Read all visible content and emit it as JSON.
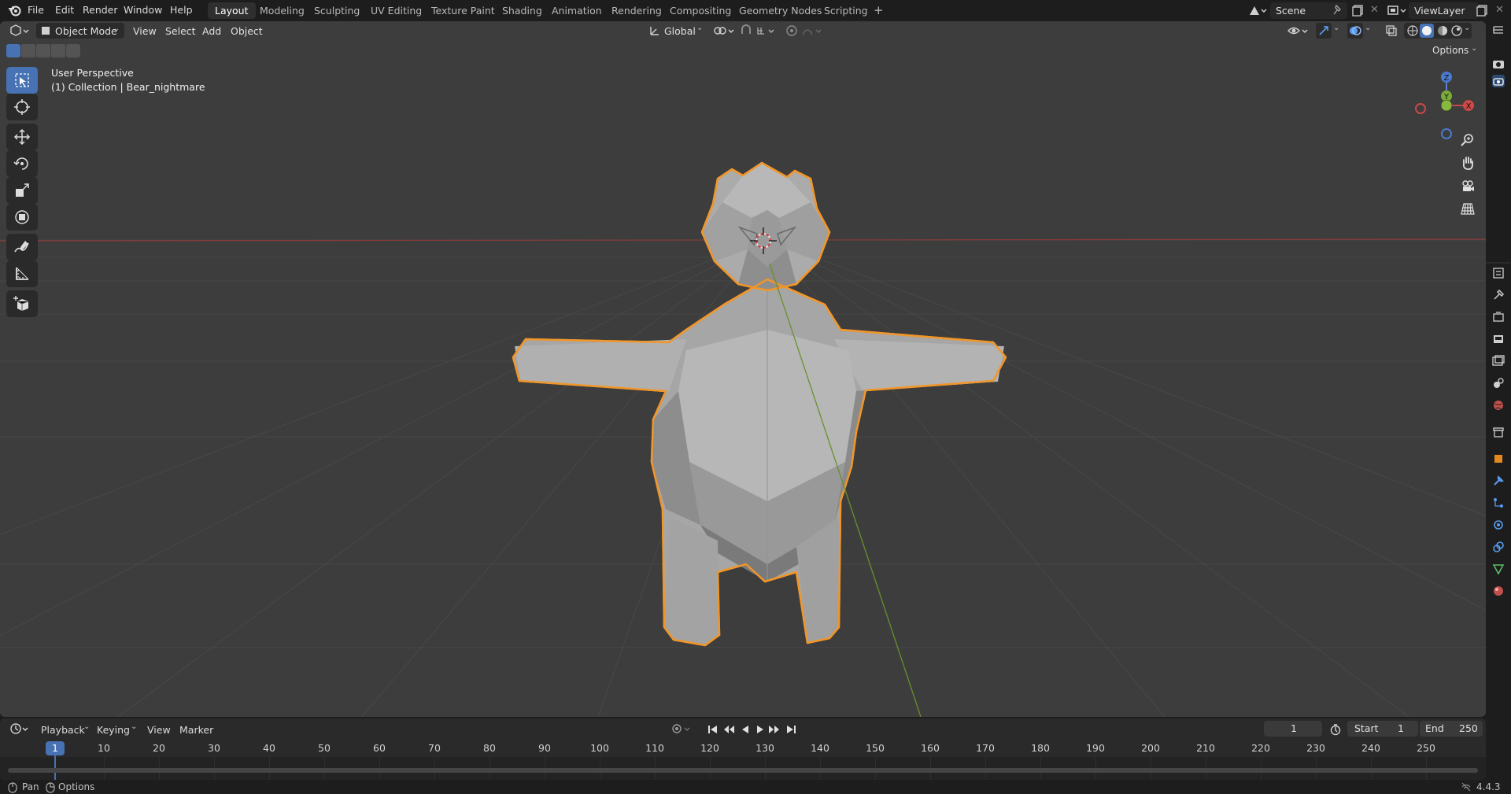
{
  "topbar": {
    "menu": [
      "File",
      "Edit",
      "Render",
      "Window",
      "Help"
    ],
    "workspaces": [
      "Layout",
      "Modeling",
      "Sculpting",
      "UV Editing",
      "Texture Paint",
      "Shading",
      "Animation",
      "Rendering",
      "Compositing",
      "Geometry Nodes",
      "Scripting"
    ],
    "active_workspace": "Layout",
    "add_workspace": "+",
    "scene_name": "Scene",
    "view_layer": "ViewLayer"
  },
  "viewport_header": {
    "mode": "Object Mode",
    "menus": [
      "View",
      "Select",
      "Add",
      "Object"
    ],
    "transform_orientation": "Global",
    "options_label": "Options"
  },
  "viewport": {
    "perspective_label": "User Perspective",
    "collection_label": "(1) Collection | Bear_nightmare",
    "gizmo_z": "Z",
    "gizmo_y": "Y",
    "gizmo_x": "X",
    "selection_outline_color": "#f0962a",
    "mesh_color": "#a8a8a8",
    "background_color": "#3d3d3d"
  },
  "tools": [
    "select-box-icon",
    "cursor-icon",
    "move-icon",
    "rotate-icon",
    "scale-icon",
    "transform-icon",
    "annotate-icon",
    "measure-icon",
    "add-cube-icon"
  ],
  "timeline": {
    "menus": [
      "Playback",
      "Keying",
      "View",
      "Marker"
    ],
    "current_frame": "1",
    "start_label": "Start",
    "start_value": "1",
    "end_label": "End",
    "end_value": "250",
    "ticks": [
      "1",
      "10",
      "20",
      "30",
      "40",
      "50",
      "60",
      "70",
      "80",
      "90",
      "100",
      "110",
      "120",
      "130",
      "140",
      "150",
      "160",
      "170",
      "180",
      "190",
      "200",
      "210",
      "220",
      "230",
      "240",
      "250"
    ]
  },
  "statusbar": {
    "pan_label": "Pan",
    "options_label": "Options",
    "version": "4.4.3"
  }
}
